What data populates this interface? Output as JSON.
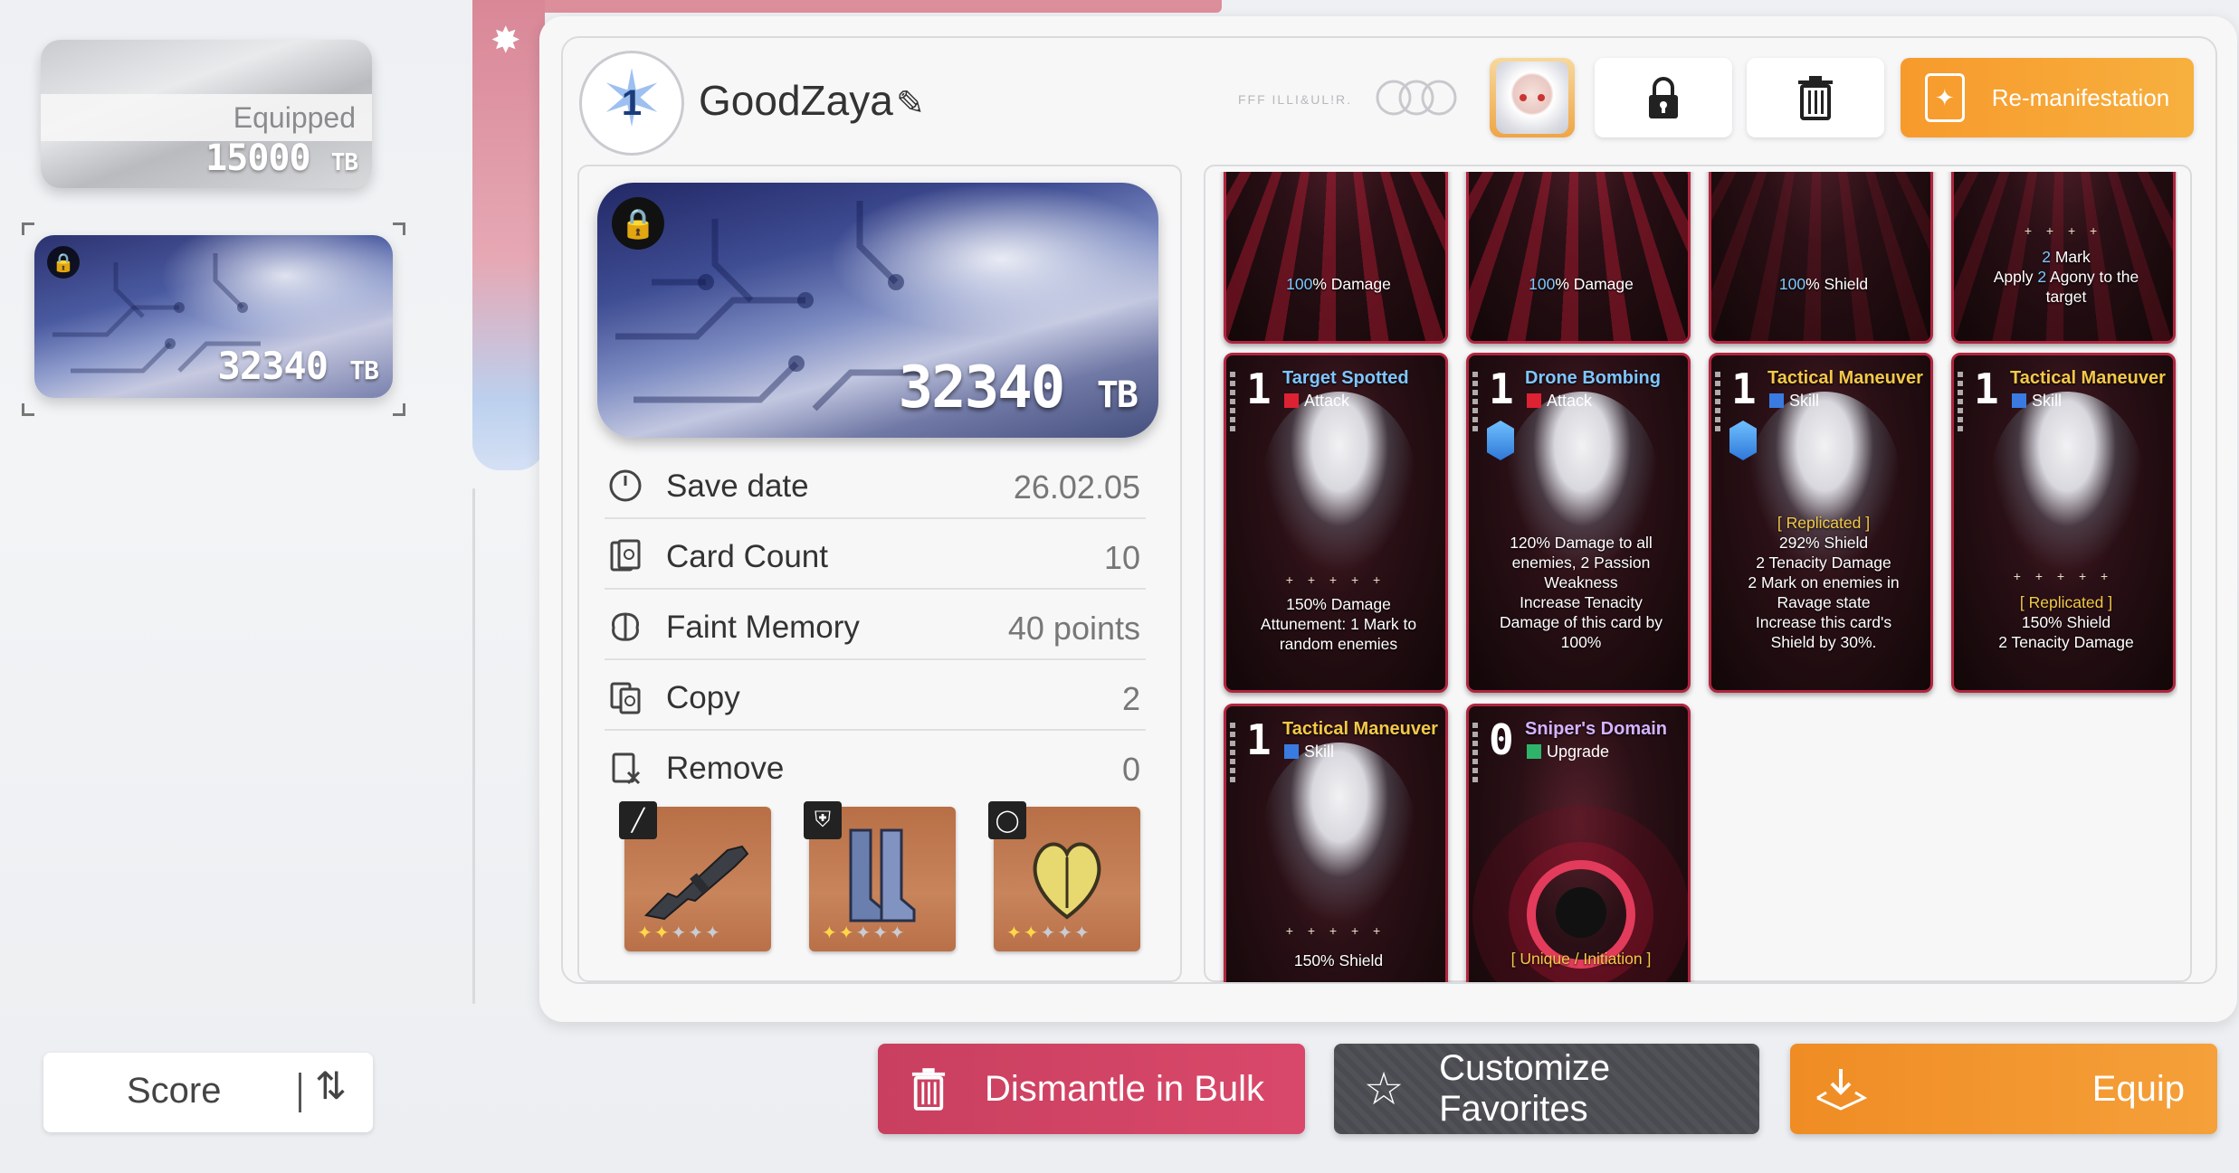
{
  "left_list": {
    "slots": [
      {
        "status": "Equipped",
        "value": "15000",
        "unit": "TB"
      },
      {
        "status": "",
        "value": "32340",
        "unit": "TB",
        "locked": true,
        "selected": true
      }
    ],
    "sort": {
      "label": "Score",
      "icon": "sort-arrows-icon"
    }
  },
  "header": {
    "rank": "1",
    "deck_name": "GoodZaya",
    "decor_text": "FFF ILLI&UL!R.",
    "buttons": {
      "character": {
        "icon": "character-portrait-icon"
      },
      "lock": {
        "icon": "padlock-icon"
      },
      "delete": {
        "icon": "trash-icon"
      },
      "remanifest": {
        "label": "Re-manifestation",
        "icon": "remanifest-icon"
      }
    }
  },
  "detail": {
    "card_value": "32340",
    "card_unit": "TB",
    "stats": [
      {
        "icon": "clock-icon",
        "label": "Save date",
        "value": "26.02.05"
      },
      {
        "icon": "card-count-icon",
        "label": "Card Count",
        "value": "10"
      },
      {
        "icon": "brain-icon",
        "label": "Faint Memory",
        "value": "40 points"
      },
      {
        "icon": "copy-icon",
        "label": "Copy",
        "value": "2"
      },
      {
        "icon": "remove-card-icon",
        "label": "Remove",
        "value": "0"
      }
    ],
    "equipment": [
      {
        "slot": "weapon",
        "item": "rifle",
        "stars_on": 2,
        "stars_total": 5
      },
      {
        "slot": "armor",
        "item": "boots",
        "stars_on": 2,
        "stars_total": 5
      },
      {
        "slot": "ring",
        "item": "gem-heart",
        "stars_on": 2,
        "stars_total": 5
      }
    ]
  },
  "cards_row1": [
    {
      "desc_hl": "100",
      "desc": "% Damage"
    },
    {
      "desc_hl": "100",
      "desc": "% Damage"
    },
    {
      "desc_hl": "100",
      "desc": "% Shield"
    },
    {
      "l1_hl": "2",
      "l1": " Mark",
      "l2a": "Apply ",
      "l2_hl": "2",
      "l2b": " Agony to the",
      "l3": "target"
    }
  ],
  "cards_row2": [
    {
      "cost": "1",
      "name": "Target Spotted",
      "type": "Attack",
      "lines": [
        "150% Damage",
        "Attunement: 1 Mark to",
        "random enemies"
      ]
    },
    {
      "cost": "1",
      "name": "Drone Bombing",
      "type": "Attack",
      "lines": [
        "120% Damage to all",
        "enemies, 2 Passion",
        "Weakness",
        "Increase Tenacity",
        "Damage of this card by",
        "100%"
      ]
    },
    {
      "cost": "1",
      "name": "Tactical Maneuver",
      "type": "Skill",
      "lines": [
        "[ Replicated ]",
        "292% Shield",
        "2 Tenacity Damage",
        "2 Mark on enemies in",
        "Ravage state",
        "Increase this card's",
        "Shield by 30%."
      ]
    },
    {
      "cost": "1",
      "name": "Tactical Maneuver",
      "type": "Skill",
      "lines": [
        "[ Replicated ]",
        "150% Shield",
        "2 Tenacity Damage"
      ]
    }
  ],
  "cards_row3": [
    {
      "cost": "1",
      "name": "Tactical Maneuver",
      "type": "Skill",
      "lines": [
        "150% Shield"
      ]
    },
    {
      "cost": "0",
      "name": "Sniper's Domain",
      "type": "Upgrade",
      "lines": [
        "[ Unique / Initiation ]"
      ]
    }
  ],
  "actions": {
    "dismantle": "Dismantle in Bulk",
    "favorites": "Customize Favorites",
    "equip": "Equip"
  },
  "colors": {
    "accent_orange": "#f5a03a",
    "dismantle_red": "#d9486a",
    "card_border": "#b0253e"
  }
}
